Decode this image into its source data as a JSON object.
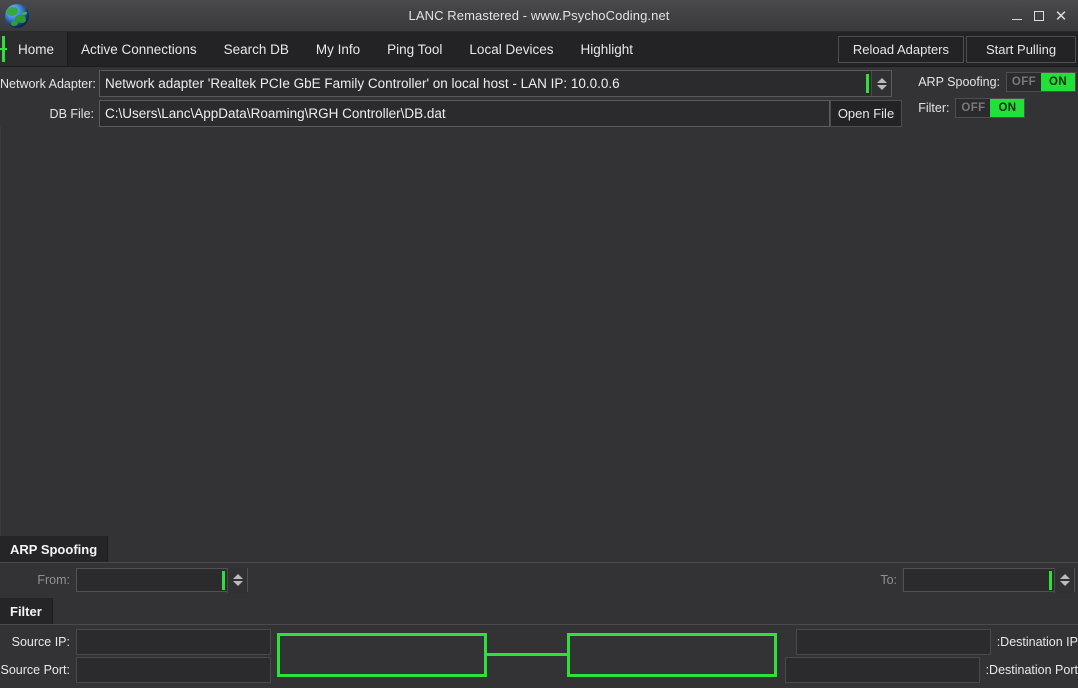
{
  "window": {
    "title": "LANC Remastered - www.PsychoCoding.net",
    "icon": "globe-icon",
    "controls": {
      "minimize": "minimize-icon",
      "maximize": "maximize-icon",
      "close": "close-icon"
    }
  },
  "tabs": [
    {
      "label": "Home",
      "active": true
    },
    {
      "label": "Active Connections",
      "active": false
    },
    {
      "label": "Search DB",
      "active": false
    },
    {
      "label": "My Info",
      "active": false
    },
    {
      "label": "Ping Tool",
      "active": false
    },
    {
      "label": "Local Devices",
      "active": false
    },
    {
      "label": "Highlight",
      "active": false
    }
  ],
  "toolbar": {
    "reload_adapters_label": "Reload Adapters",
    "start_pulling_label": "Start Pulling"
  },
  "form": {
    "adapter_label": "Network Adapter:",
    "adapter_value": "Network adapter 'Realtek PCIe GbE Family Controller' on local host - LAN IP: 10.0.0.6",
    "db_label": "DB File:",
    "db_value": "C:\\Users\\Lanc\\AppData\\Roaming\\RGH Controller\\DB.dat",
    "open_file_label": "Open File"
  },
  "toggles": [
    {
      "label": "ARP Spoofing:",
      "off_label": "OFF",
      "on_label": "ON",
      "state": "ON"
    },
    {
      "label": "Filter:",
      "off_label": "OFF",
      "on_label": "ON",
      "state": "ON"
    }
  ],
  "arp_panel": {
    "title": "ARP Spoofing",
    "from_label": "From:",
    "from_value": "",
    "to_label": "To:",
    "to_value": ""
  },
  "filter_panel": {
    "title": "Filter",
    "source_ip_label": "Source IP:",
    "source_ip_value": "",
    "source_port_label": "Source Port:",
    "source_port_value": "",
    "destination_ip_label": ":Destination IP",
    "destination_ip_value": "",
    "destination_port_label": ":Destination Port",
    "destination_port_value": ""
  },
  "colors": {
    "accent_green": "#2ee03a",
    "toggle_on_green": "#22e03a",
    "window_bg": "#333335",
    "tabbar_bg": "#232325",
    "field_bg": "#2b2b2d"
  }
}
